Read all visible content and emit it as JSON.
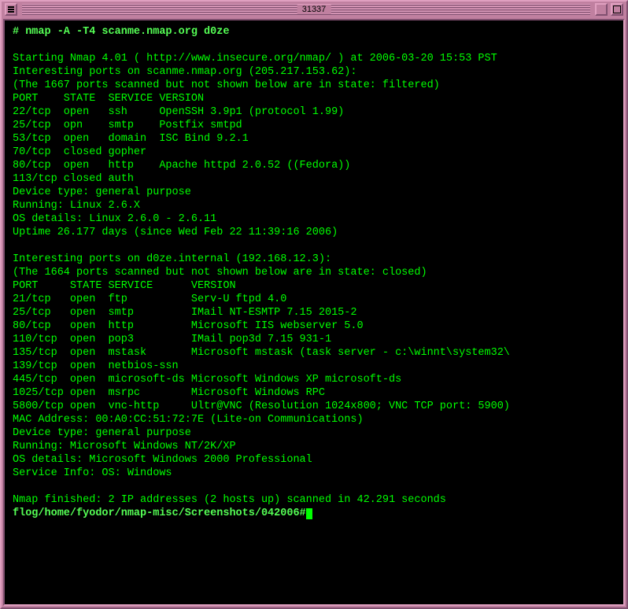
{
  "window": {
    "title": "31337"
  },
  "cmd": "# nmap -A -T4 scanme.nmap.org d0ze",
  "intro1": "Starting Nmap 4.01 ( http://www.insecure.org/nmap/ ) at 2006-03-20 15:53 PST",
  "intro2": "Interesting ports on scanme.nmap.org (205.217.153.62):",
  "intro3": "(The 1667 ports scanned but not shown below are in state: filtered)",
  "hdr1": "PORT    STATE  SERVICE VERSION",
  "h1r1": "22/tcp  open   ssh     OpenSSH 3.9p1 (protocol 1.99)",
  "h1r2": "25/tcp  opn    smtp    Postfix smtpd",
  "h1r3": "53/tcp  open   domain  ISC Bind 9.2.1",
  "h1r4": "70/tcp  closed gopher",
  "h1r5": "80/tcp  open   http    Apache httpd 2.0.52 ((Fedora))",
  "h1r6": "113/tcp closed auth",
  "h1dev": "Device type: general purpose",
  "h1run": "Running: Linux 2.6.X",
  "h1os": "OS details: Linux 2.6.0 - 2.6.11",
  "h1up": "Uptime 26.177 days (since Wed Feb 22 11:39:16 2006)",
  "host2a": "Interesting ports on d0ze.internal (192.168.12.3):",
  "host2b": "(The 1664 ports scanned but not shown below are in state: closed)",
  "hdr2": "PORT     STATE SERVICE      VERSION",
  "h2r1": "21/tcp   open  ftp          Serv-U ftpd 4.0",
  "h2r2": "25/tcp   open  smtp         IMail NT-ESMTP 7.15 2015-2",
  "h2r3": "80/tcp   open  http         Microsoft IIS webserver 5.0",
  "h2r4": "110/tcp  open  pop3         IMail pop3d 7.15 931-1",
  "h2r5": "135/tcp  open  mstask       Microsoft mstask (task server - c:\\winnt\\system32\\",
  "h2r6": "139/tcp  open  netbios-ssn",
  "h2r7": "445/tcp  open  microsoft-ds Microsoft Windows XP microsoft-ds",
  "h2r8": "1025/tcp open  msrpc        Microsoft Windows RPC",
  "h2r9": "5800/tcp open  vnc-http     Ultr@VNC (Resolution 1024x800; VNC TCP port: 5900)",
  "h2mac": "MAC Address: 00:A0:CC:51:72:7E (Lite-on Communications)",
  "h2dev": "Device type: general purpose",
  "h2run": "Running: Microsoft Windows NT/2K/XP",
  "h2os": "OS details: Microsoft Windows 2000 Professional",
  "h2svc": "Service Info: OS: Windows",
  "fin": "Nmap finished: 2 IP addresses (2 hosts up) scanned in 42.291 seconds",
  "prompt": "flog/home/fyodor/nmap-misc/Screenshots/042006#"
}
